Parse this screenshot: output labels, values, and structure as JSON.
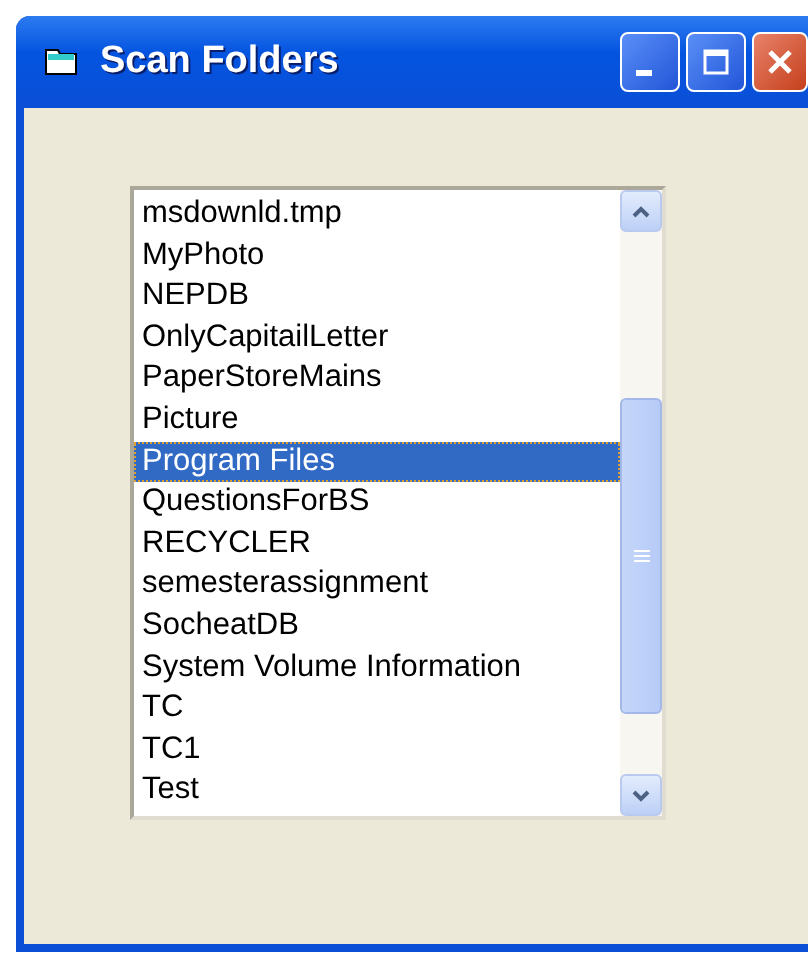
{
  "window": {
    "title": "Scan Folders"
  },
  "folders": [
    {
      "name": "msdownld.tmp",
      "selected": false
    },
    {
      "name": "MyPhoto",
      "selected": false
    },
    {
      "name": "NEPDB",
      "selected": false
    },
    {
      "name": "OnlyCapitailLetter",
      "selected": false
    },
    {
      "name": "PaperStoreMains",
      "selected": false
    },
    {
      "name": "Picture",
      "selected": false
    },
    {
      "name": "Program Files",
      "selected": true
    },
    {
      "name": "QuestionsForBS",
      "selected": false
    },
    {
      "name": "RECYCLER",
      "selected": false
    },
    {
      "name": "semesterassignment",
      "selected": false
    },
    {
      "name": "SocheatDB",
      "selected": false
    },
    {
      "name": "System Volume Information",
      "selected": false
    },
    {
      "name": "TC",
      "selected": false
    },
    {
      "name": "TC1",
      "selected": false
    },
    {
      "name": "Test",
      "selected": false
    }
  ]
}
